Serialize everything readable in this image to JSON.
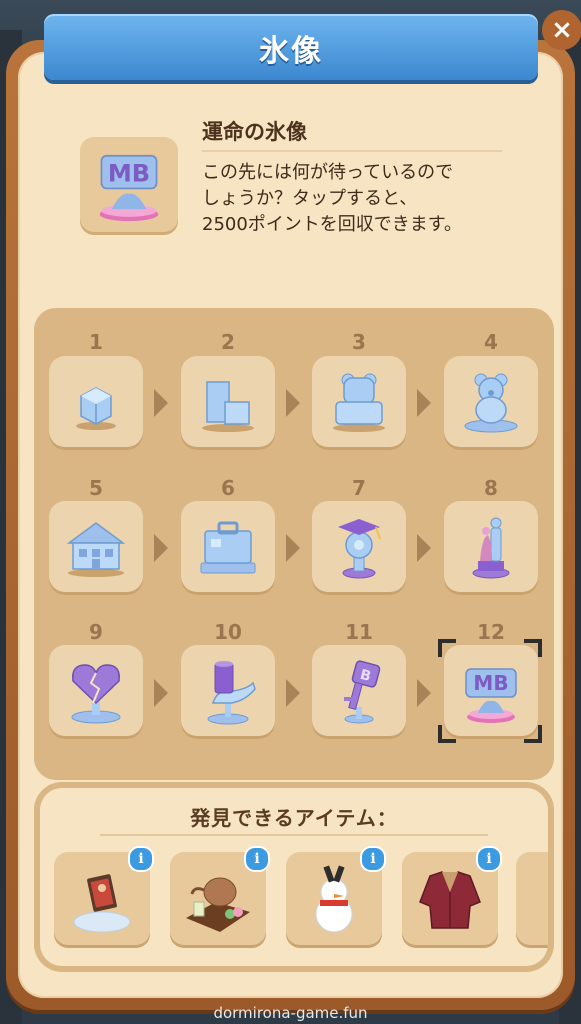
{
  "window": {
    "title": "氷像",
    "close_label": "×"
  },
  "hero": {
    "icon": "mb-ice-statue-icon",
    "title": "運命の氷像",
    "description": "この先には何が待っているので\nしょうか？タップすると、\n2500ポイントを回収できます。"
  },
  "stages": [
    {
      "num": "1",
      "icon": "ice-cube-icon"
    },
    {
      "num": "2",
      "icon": "ice-blocks-icon"
    },
    {
      "num": "3",
      "icon": "bear-carving-rough-icon"
    },
    {
      "num": "4",
      "icon": "teddy-bear-statue-icon"
    },
    {
      "num": "5",
      "icon": "house-statue-icon"
    },
    {
      "num": "6",
      "icon": "suitcase-statue-icon"
    },
    {
      "num": "7",
      "icon": "graduation-trophy-icon"
    },
    {
      "num": "8",
      "icon": "couple-statue-icon"
    },
    {
      "num": "9",
      "icon": "broken-heart-statue-icon"
    },
    {
      "num": "10",
      "icon": "hand-cup-statue-icon"
    },
    {
      "num": "11",
      "icon": "key-statue-icon"
    },
    {
      "num": "12",
      "icon": "mb-statue-icon"
    }
  ],
  "selected_stage": "12",
  "items": {
    "title": "発見できるアイテム：",
    "list": [
      {
        "icon": "photo-frame-in-snow-icon",
        "info": "i"
      },
      {
        "icon": "teapot-tray-icon",
        "info": "i"
      },
      {
        "icon": "snowman-icon",
        "info": "i"
      },
      {
        "icon": "red-jacket-icon",
        "info": "i"
      }
    ]
  },
  "watermark": "dormirona-game.fun"
}
